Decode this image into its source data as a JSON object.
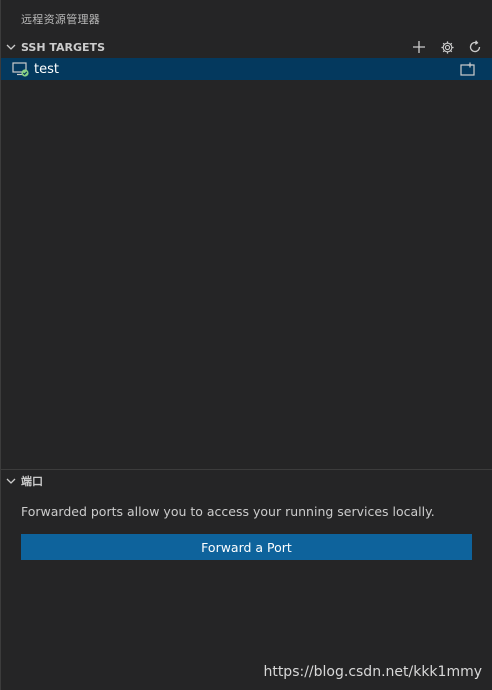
{
  "view": {
    "title": "远程资源管理器"
  },
  "ssh_targets": {
    "title": "SSH TARGETS",
    "actions": [
      {
        "icon": "plus-icon",
        "label": "add"
      },
      {
        "icon": "gear-icon",
        "label": "configure"
      },
      {
        "icon": "refresh-icon",
        "label": "refresh"
      }
    ],
    "items": [
      {
        "label": "test",
        "icon": "remote-monitor-connected-icon",
        "status": "connected"
      }
    ]
  },
  "ports": {
    "title": "端口",
    "message": "Forwarded ports allow you to access your running services locally.",
    "button_label": "Forward a Port"
  },
  "watermark": "https://blog.csdn.net/kkk1mmy",
  "colors": {
    "background": "#252526",
    "selection": "#04395e",
    "button": "#0e639c",
    "status_ok": "#89d185"
  }
}
